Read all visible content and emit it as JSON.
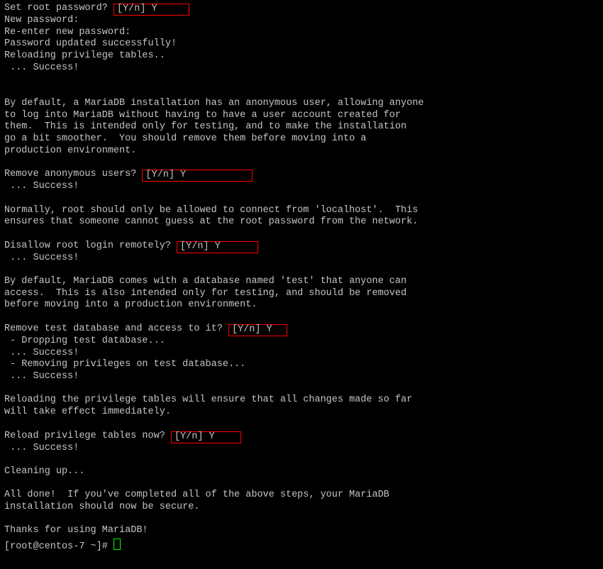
{
  "lines": [
    {
      "pre": "Set root password? ",
      "hl": "[Y/n] Y     ",
      "post": ""
    },
    {
      "pre": "New password:",
      "hl": "",
      "post": ""
    },
    {
      "pre": "Re-enter new password:",
      "hl": "",
      "post": ""
    },
    {
      "pre": "Password updated successfully!",
      "hl": "",
      "post": ""
    },
    {
      "pre": "Reloading privilege tables..",
      "hl": "",
      "post": ""
    },
    {
      "pre": " ... Success!",
      "hl": "",
      "post": ""
    },
    {
      "pre": "",
      "hl": "",
      "post": ""
    },
    {
      "pre": "",
      "hl": "",
      "post": ""
    },
    {
      "pre": "By default, a MariaDB installation has an anonymous user, allowing anyone",
      "hl": "",
      "post": ""
    },
    {
      "pre": "to log into MariaDB without having to have a user account created for",
      "hl": "",
      "post": ""
    },
    {
      "pre": "them.  This is intended only for testing, and to make the installation",
      "hl": "",
      "post": ""
    },
    {
      "pre": "go a bit smoother.  You should remove them before moving into a",
      "hl": "",
      "post": ""
    },
    {
      "pre": "production environment.",
      "hl": "",
      "post": ""
    },
    {
      "pre": "",
      "hl": "",
      "post": ""
    },
    {
      "pre": "Remove anonymous users? ",
      "hl": "[Y/n] Y           ",
      "post": ""
    },
    {
      "pre": " ... Success!",
      "hl": "",
      "post": ""
    },
    {
      "pre": "",
      "hl": "",
      "post": ""
    },
    {
      "pre": "Normally, root should only be allowed to connect from 'localhost'.  This",
      "hl": "",
      "post": ""
    },
    {
      "pre": "ensures that someone cannot guess at the root password from the network.",
      "hl": "",
      "post": ""
    },
    {
      "pre": "",
      "hl": "",
      "post": ""
    },
    {
      "pre": "Disallow root login remotely? ",
      "hl": "[Y/n] Y      ",
      "post": ""
    },
    {
      "pre": " ... Success!",
      "hl": "",
      "post": ""
    },
    {
      "pre": "",
      "hl": "",
      "post": ""
    },
    {
      "pre": "By default, MariaDB comes with a database named 'test' that anyone can",
      "hl": "",
      "post": ""
    },
    {
      "pre": "access.  This is also intended only for testing, and should be removed",
      "hl": "",
      "post": ""
    },
    {
      "pre": "before moving into a production environment.",
      "hl": "",
      "post": ""
    },
    {
      "pre": "",
      "hl": "",
      "post": ""
    },
    {
      "pre": "Remove test database and access to it? ",
      "hl": "[Y/n] Y  ",
      "post": ""
    },
    {
      "pre": " - Dropping test database...",
      "hl": "",
      "post": ""
    },
    {
      "pre": " ... Success!",
      "hl": "",
      "post": ""
    },
    {
      "pre": " - Removing privileges on test database...",
      "hl": "",
      "post": ""
    },
    {
      "pre": " ... Success!",
      "hl": "",
      "post": ""
    },
    {
      "pre": "",
      "hl": "",
      "post": ""
    },
    {
      "pre": "Reloading the privilege tables will ensure that all changes made so far",
      "hl": "",
      "post": ""
    },
    {
      "pre": "will take effect immediately.",
      "hl": "",
      "post": ""
    },
    {
      "pre": "",
      "hl": "",
      "post": ""
    },
    {
      "pre": "Reload privilege tables now? ",
      "hl": "[Y/n] Y    ",
      "post": ""
    },
    {
      "pre": " ... Success!",
      "hl": "",
      "post": ""
    },
    {
      "pre": "",
      "hl": "",
      "post": ""
    },
    {
      "pre": "Cleaning up...",
      "hl": "",
      "post": ""
    },
    {
      "pre": "",
      "hl": "",
      "post": ""
    },
    {
      "pre": "All done!  If you've completed all of the above steps, your MariaDB",
      "hl": "",
      "post": ""
    },
    {
      "pre": "installation should now be secure.",
      "hl": "",
      "post": ""
    },
    {
      "pre": "",
      "hl": "",
      "post": ""
    },
    {
      "pre": "Thanks for using MariaDB!",
      "hl": "",
      "post": ""
    }
  ],
  "prompt": "[root@centos-7 ~]# "
}
